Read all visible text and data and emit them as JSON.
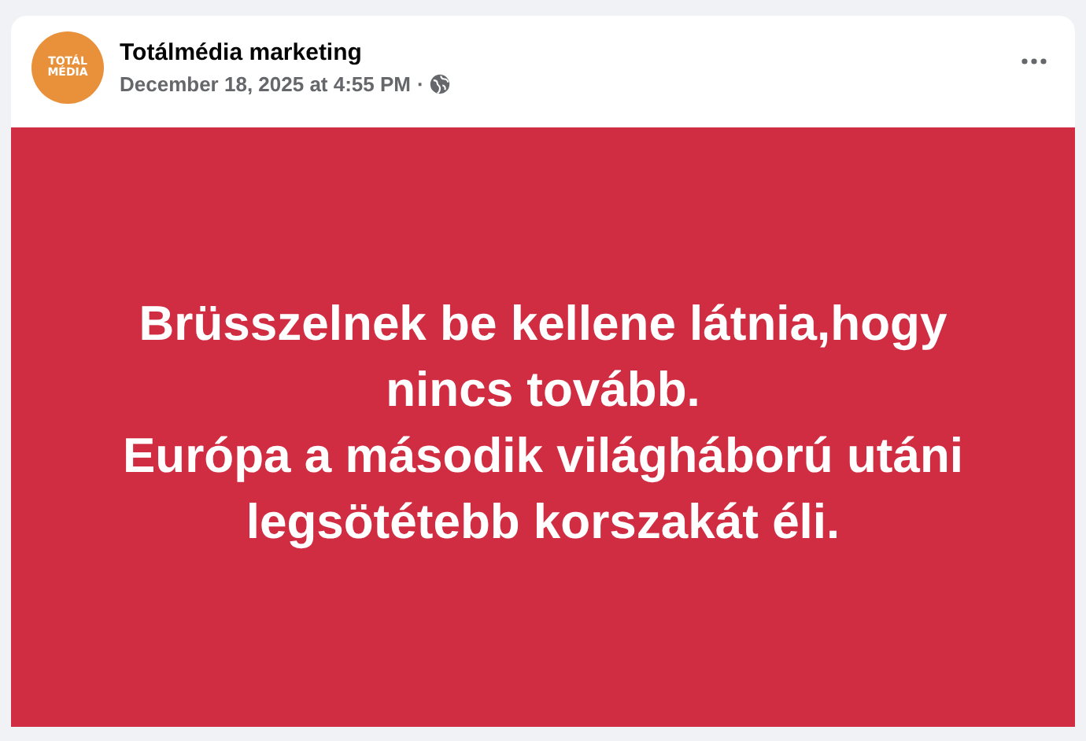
{
  "post": {
    "avatar": {
      "logo_lines": [
        "TOTÁL",
        "MÉDIA"
      ]
    },
    "author": "Totálmédia marketing",
    "timestamp": "December 18, 2025 at 4:55 PM",
    "separator": "·",
    "public": true,
    "card": {
      "lines": [
        "Brüsszelnek be kellene látnia,hogy",
        "nincs tovább.",
        "Európa a második világháború utáni",
        "legsötétebb korszakát éli."
      ]
    }
  }
}
